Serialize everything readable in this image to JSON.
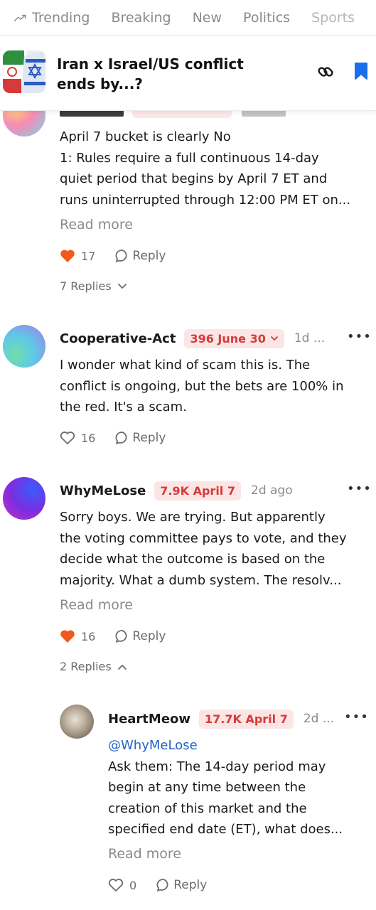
{
  "nav": {
    "items": [
      "Trending",
      "Breaking",
      "New",
      "Politics",
      "Sports"
    ]
  },
  "header": {
    "title_line1": "Iran x Israel/US conflict",
    "title_line2": "ends by...?"
  },
  "comments": [
    {
      "body": [
        "April 7 bucket is clearly No",
        "1: Rules require a full continuous 14-day",
        "quiet period that begins by April 7 ET and",
        "runs uninterrupted through 12:00 PM ET on..."
      ],
      "read_more": "Read more",
      "likes": "17",
      "liked": true,
      "reply_label": "Reply",
      "replies_label": "7 Replies"
    },
    {
      "username": "Cooperative-Act",
      "position": "396 June 30",
      "time": "1d ...",
      "body": [
        "I wonder what kind of scam this is. The",
        "conflict is ongoing, but the bets are 100% in",
        "the red. It's a scam."
      ],
      "likes": "16",
      "liked": false,
      "reply_label": "Reply"
    },
    {
      "username": "WhyMeLose",
      "position": "7.9K April 7",
      "time": "2d ago",
      "body": [
        "Sorry boys. We are trying. But apparently",
        "the voting committee pays to vote, and they",
        "decide what the outcome is based on the",
        "majority. What a dumb system. The resolv..."
      ],
      "read_more": "Read more",
      "likes": "16",
      "liked": true,
      "reply_label": "Reply",
      "replies_label": "2 Replies"
    },
    {
      "username": "HeartMeow",
      "position": "17.7K April 7",
      "time": "2d ...",
      "mention": "@WhyMeLose",
      "body": [
        "Ask them: The 14-day period may",
        "begin at any time between the",
        "creation of this market and the",
        "specified end date (ET), what does..."
      ],
      "read_more": "Read more",
      "likes": "0",
      "liked": false,
      "reply_label": "Reply"
    }
  ],
  "colors": {
    "accent_red": "#d73a3a",
    "pill_bg": "#fbe5e5",
    "like_orange": "#f05a1e",
    "mention_blue": "#2563c9",
    "bookmark_blue": "#1a6ff0"
  }
}
